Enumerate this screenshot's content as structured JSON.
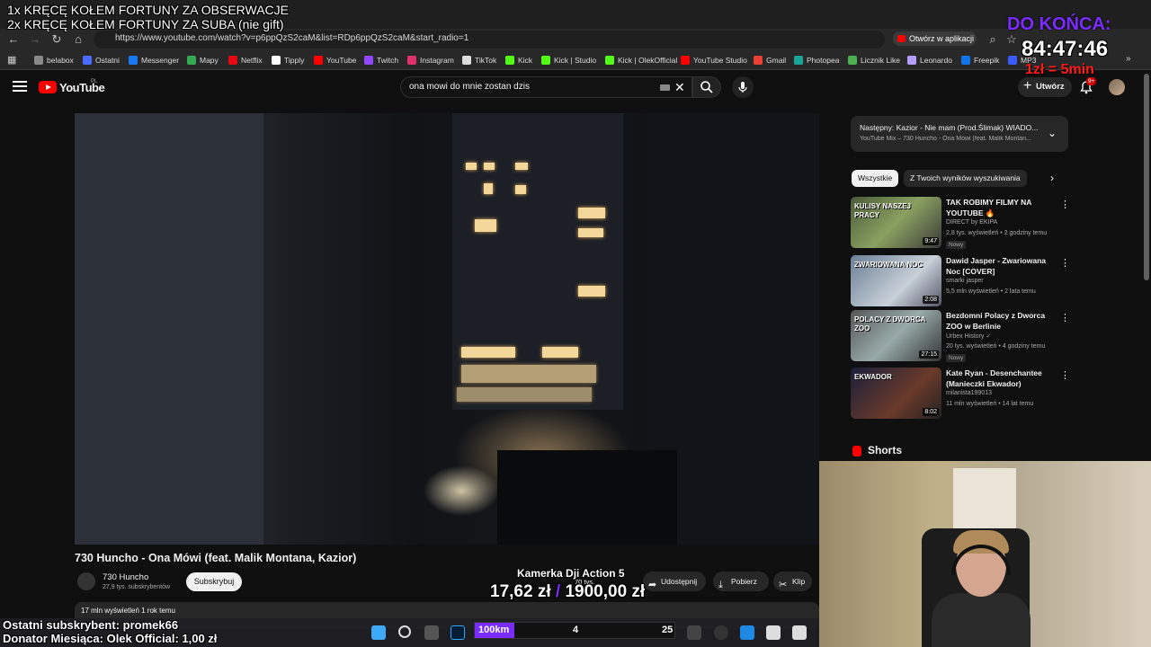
{
  "overlay": {
    "line1": "1x KRĘCĘ KOŁEM FORTUNY ZA OBSERWACJE",
    "line2": "2x KRĘCĘ KOŁEM FORTUNY ZA SUBA (nie gift)",
    "countdown_title": "DO KOŃCA:",
    "countdown_time": "84:47:46",
    "countdown_rate": "1zł = 5min",
    "camera_label": "Kamerka Dji Action 5",
    "money_current": "17,62 zł",
    "money_separator": "/",
    "money_goal": "1900,00 zł",
    "last_sub": "Ostatni subskrybent: promek66",
    "donator": "Donator Miesiąca: Olek Official: 1,00 zł",
    "km_label": "100km",
    "km_mid": "4",
    "km_right": "25",
    "km_fill_fraction": 0.2
  },
  "browser": {
    "url": "https://www.youtube.com/watch?v=p6ppQzS2caM&list=RDp6ppQzS2caM&start_radio=1",
    "open_app_label": "Otwórz w aplikacji",
    "bookmarks": [
      {
        "label": "belabox",
        "color": "#888888"
      },
      {
        "label": "Ostatni",
        "color": "#4b6bff"
      },
      {
        "label": "Messenger",
        "color": "#1877f2"
      },
      {
        "label": "Mapy",
        "color": "#34a853"
      },
      {
        "label": "Netflix",
        "color": "#e50914"
      },
      {
        "label": "Tipply",
        "color": "#ffffff"
      },
      {
        "label": "YouTube",
        "color": "#ff0000"
      },
      {
        "label": "Twitch",
        "color": "#9146ff"
      },
      {
        "label": "Instagram",
        "color": "#e1306c"
      },
      {
        "label": "TikTok",
        "color": "#dddddd"
      },
      {
        "label": "Kick",
        "color": "#53fc18"
      },
      {
        "label": "Kick | Studio",
        "color": "#53fc18"
      },
      {
        "label": "Kick | OlekOfficial",
        "color": "#53fc18"
      },
      {
        "label": "YouTube Studio",
        "color": "#ff0000"
      },
      {
        "label": "Gmail",
        "color": "#ea4335"
      },
      {
        "label": "Photopea",
        "color": "#18a497"
      },
      {
        "label": "Licznik Like",
        "color": "#4caf50"
      },
      {
        "label": "Leonardo",
        "color": "#b59cff"
      },
      {
        "label": "Freepik",
        "color": "#1273eb"
      },
      {
        "label": "MP3",
        "color": "#3b5bff"
      }
    ]
  },
  "youtube": {
    "logo_text": "YouTube",
    "logo_region": "PL",
    "search_value": "ona mowi do mnie zostan dzis",
    "create_label": "Utwórz",
    "notifications_badge": "9+",
    "video": {
      "title": "730 Huncho - Ona Mówi (feat. Malik Montana, Kazior)",
      "channel": "730 Huncho",
      "subscribers": "27,9 tys. subskrybentów",
      "subscribe_label": "Subskrybuj",
      "likes": "70 tys.",
      "share_label": "Udostępnij",
      "download_label": "Pobierz",
      "clip_label": "Klip",
      "views_date": "17 mln wyświetleń  1 rok temu"
    },
    "up_next": {
      "title": "Następny: Kazior - Nie mam (Prod.Ślimak) WIADO...",
      "subtitle": "YouTube Mix – 730 Huncho - Ona Mówi (feat. Malik Montan..."
    },
    "chips": [
      "Wszystkie",
      "Z Twoich wyników wyszukiwania"
    ],
    "recommendations": [
      {
        "title": "TAK ROBIMY FILMY NA YOUTUBE 🔥",
        "channel": "DIRECT by EKIPA",
        "meta": "2,8 tys. wyświetleń • 2 godziny temu",
        "badge": "Nowy",
        "duration": "9:47",
        "thumb_text": "KULISY NASZEJ PRACY"
      },
      {
        "title": "Dawid Jasper - Zwariowana Noc [COVER]",
        "channel": "smarki jasper",
        "meta": "5,5 mln wyświetleń • 2 lata temu",
        "badge": "",
        "duration": "2:08",
        "thumb_text": "ZWARIOWANA NOC"
      },
      {
        "title": "Bezdomni Polacy z Dworca ZOO w Berlinie",
        "channel": "Urbex History ✓",
        "meta": "20 tys. wyświetleń • 4 godziny temu",
        "badge": "Nowy",
        "duration": "27:15",
        "thumb_text": "POLACY Z DWORCA ZOO"
      },
      {
        "title": "Kate Ryan - Desenchantee (Manieczki Ekwador)",
        "channel": "milanista199013",
        "meta": "11 mln wyświetleń • 14 lat temu",
        "badge": "",
        "duration": "8:02",
        "thumb_text": "EKWADOR"
      }
    ],
    "shorts_label": "Shorts"
  },
  "colors": {
    "accent_purple": "#7a2cff",
    "countdown_red": "#ff1a1a",
    "youtube_red": "#ff0000"
  }
}
